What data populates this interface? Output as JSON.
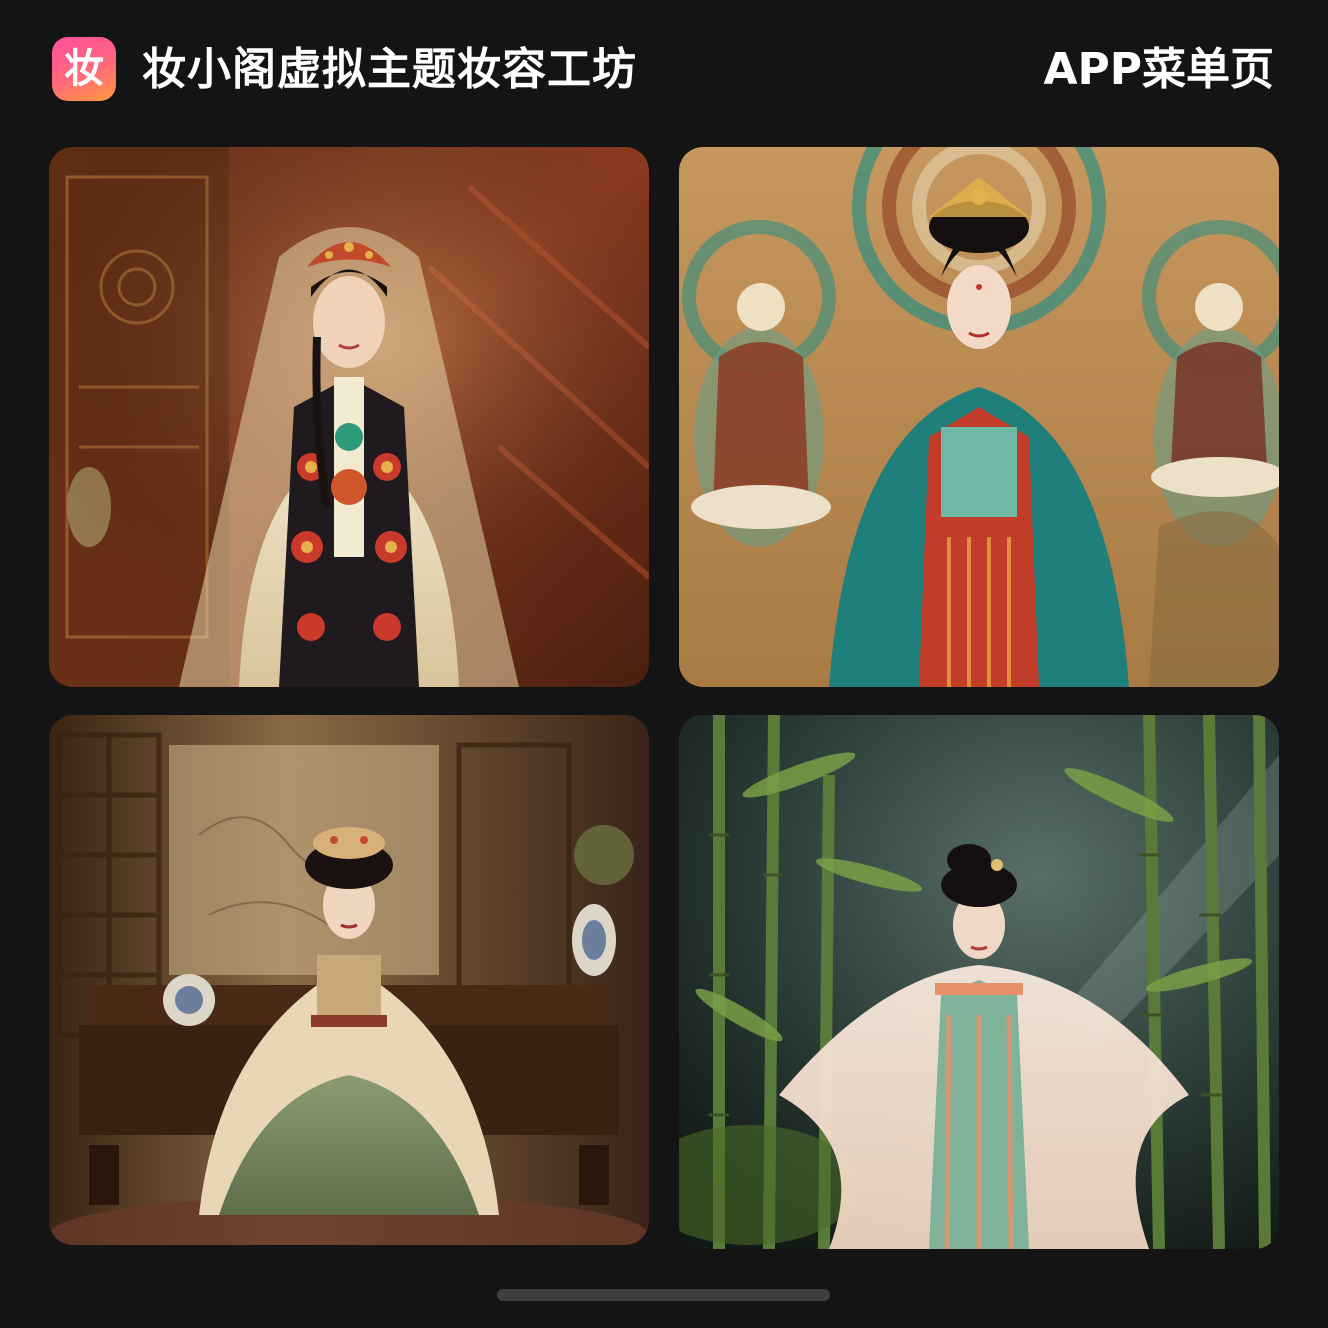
{
  "header": {
    "app_icon_glyph": "妆",
    "app_title": "妆小阁虚拟主题妆容工坊",
    "page_label": "APP菜单页"
  },
  "colors": {
    "background": "#141414",
    "icon_gradient": [
      "#ff4f9e",
      "#ff9a3d"
    ],
    "text": "#ffffff"
  },
  "cards": [
    {
      "name": "theme-card-embroidered-bridal"
    },
    {
      "name": "theme-card-dunhuang-mural"
    },
    {
      "name": "theme-card-palace-interior"
    },
    {
      "name": "theme-card-bamboo-forest"
    }
  ]
}
